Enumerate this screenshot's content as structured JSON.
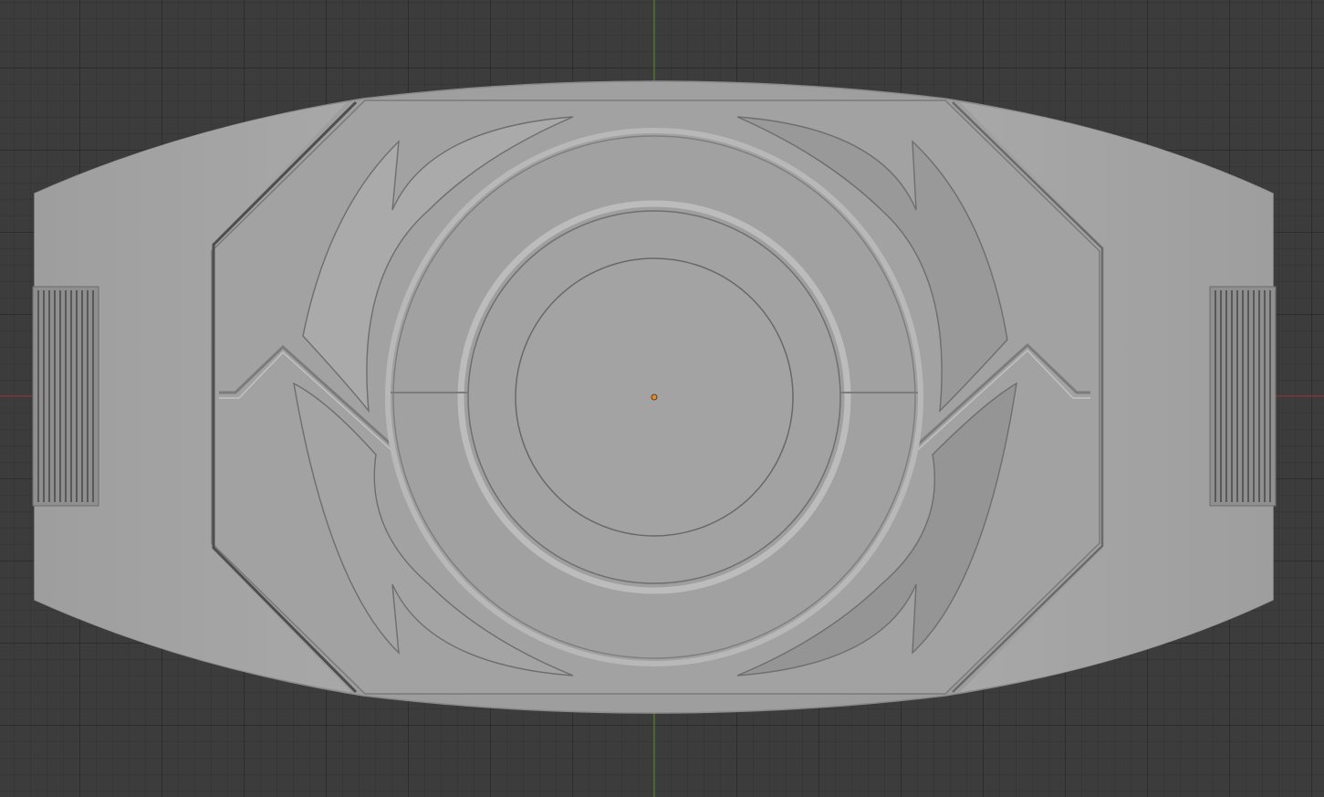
{
  "app": {
    "editor": "3D Viewport",
    "view": "orthographic-top"
  },
  "viewport": {
    "background_color": "#3c3c3c",
    "grid_line_color": "#2e2e2e",
    "axis_x_color": "#9b3a44",
    "axis_y_color": "#5f8a2b"
  },
  "object": {
    "name_visible": false,
    "shading": "solid",
    "base_color": "#a3a3a3",
    "highlight_color": "#b9b9b9",
    "shadow_color": "#7e7e7e",
    "groove_color": "#5a5a5a",
    "origin_color": "#e8892a"
  }
}
